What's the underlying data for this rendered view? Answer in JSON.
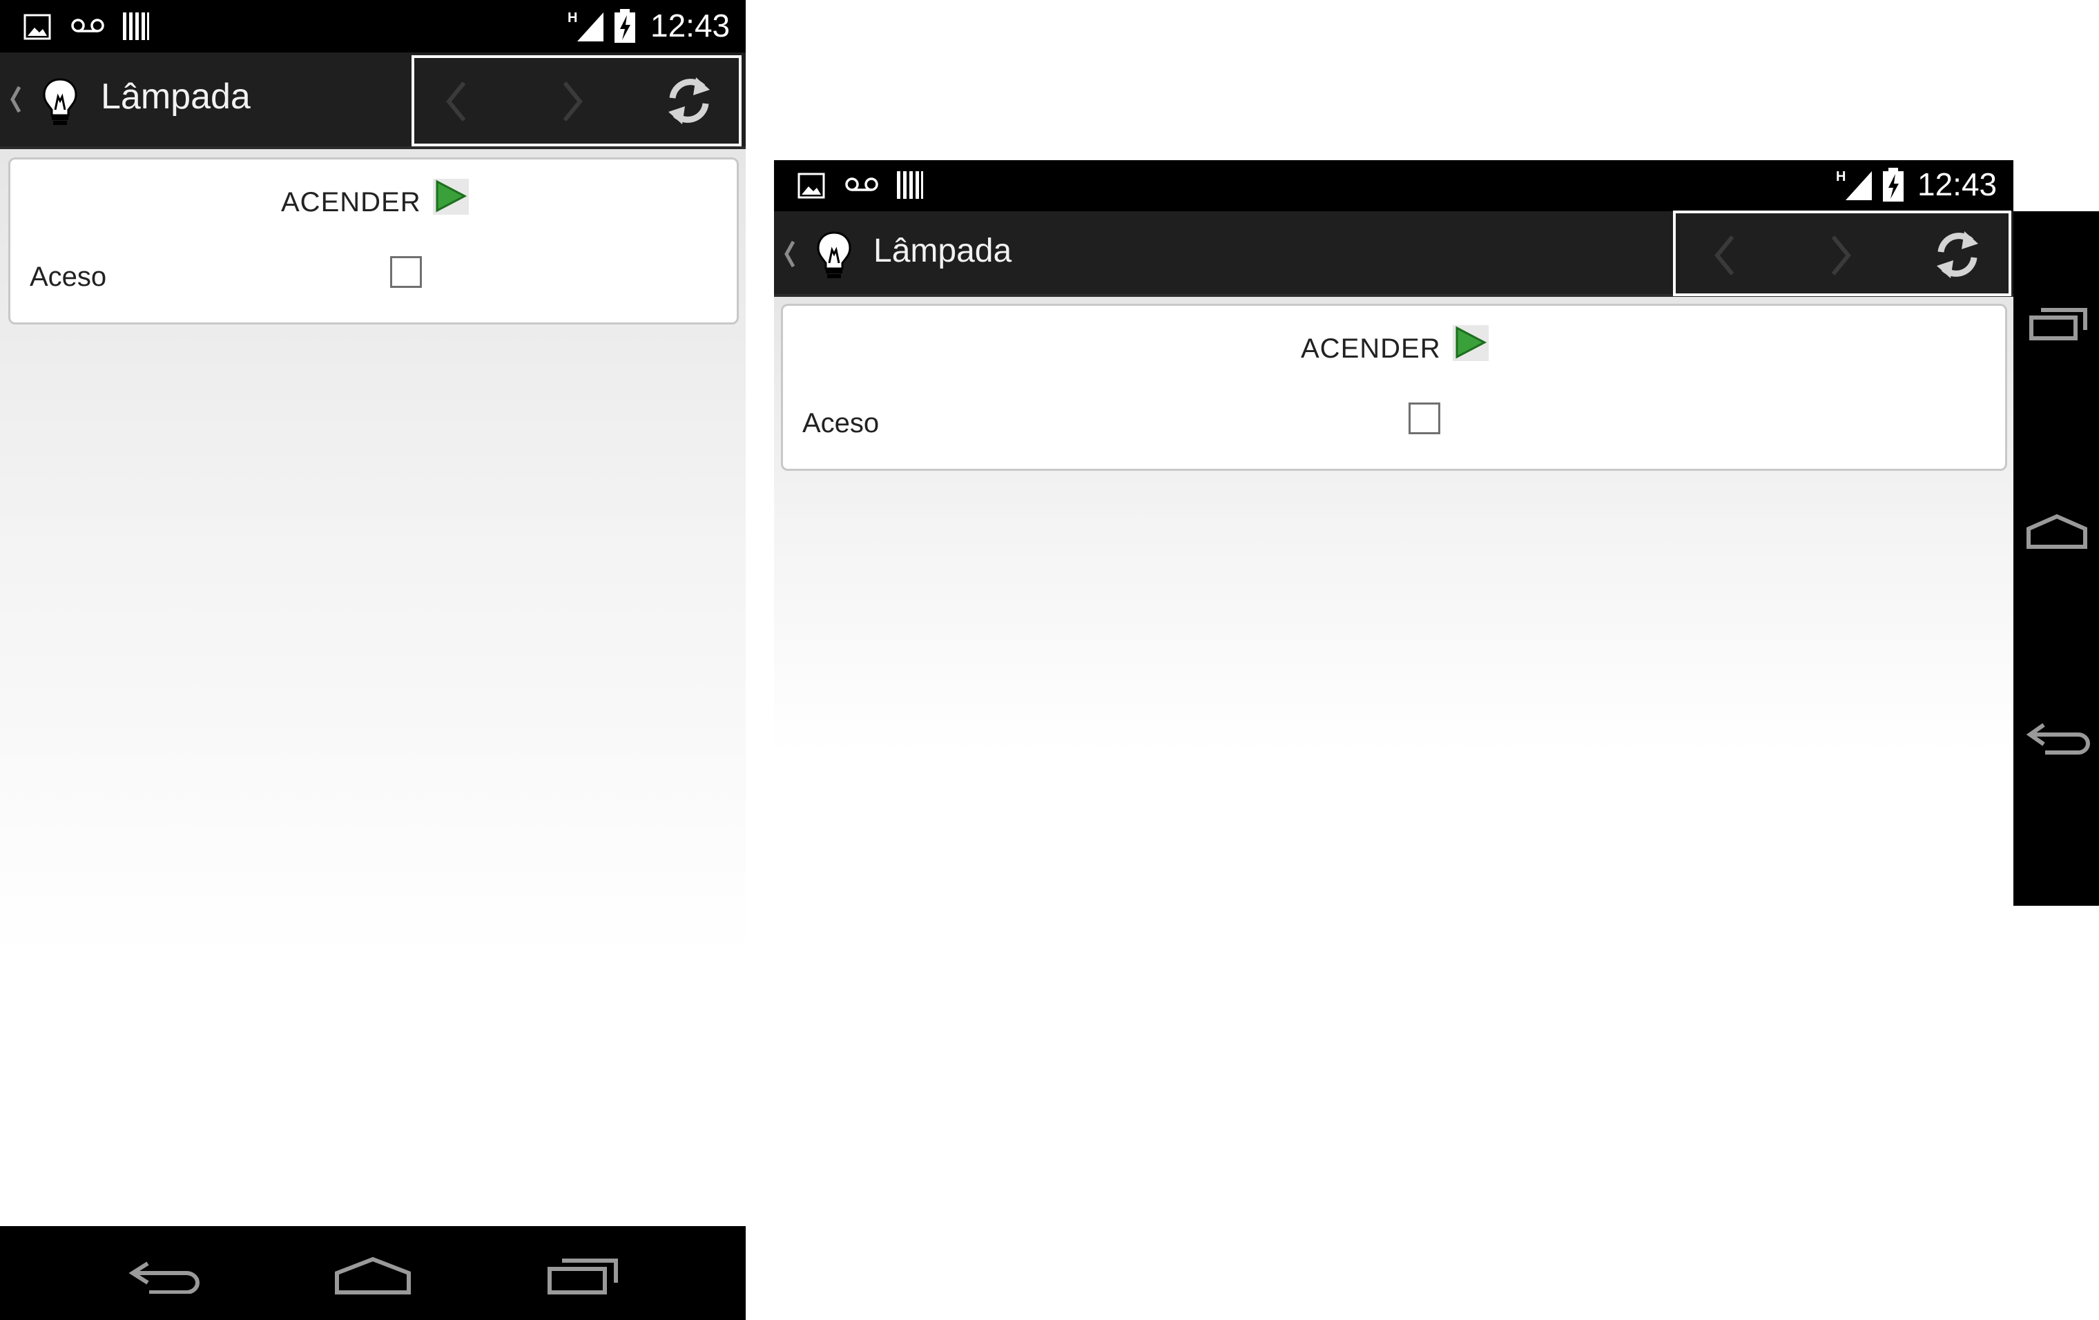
{
  "status_bar": {
    "time": "12:43",
    "left_icons": [
      "image-notification-icon",
      "voicemail-icon",
      "barcode-notification-icon"
    ],
    "right_icons": [
      "h-signal-icon",
      "battery-charging-icon"
    ]
  },
  "app_bar": {
    "title": "Lâmpada",
    "app_icon": "lightbulb-icon",
    "actions": [
      "back-arrow-icon",
      "forward-arrow-icon",
      "refresh-icon"
    ]
  },
  "form": {
    "action_label": "ACENDER",
    "action_icon": "play-triangle-icon",
    "field_label": "Aceso",
    "field_checked": false
  },
  "system_nav": [
    "back-nav-icon",
    "home-nav-icon",
    "recent-apps-nav-icon"
  ],
  "colors": {
    "status_bar": "#000000",
    "app_bar": "#1f1f1f",
    "play_green": "#3aa13a",
    "content_top": "#e6e6e6",
    "content_bottom": "#ffffff"
  }
}
